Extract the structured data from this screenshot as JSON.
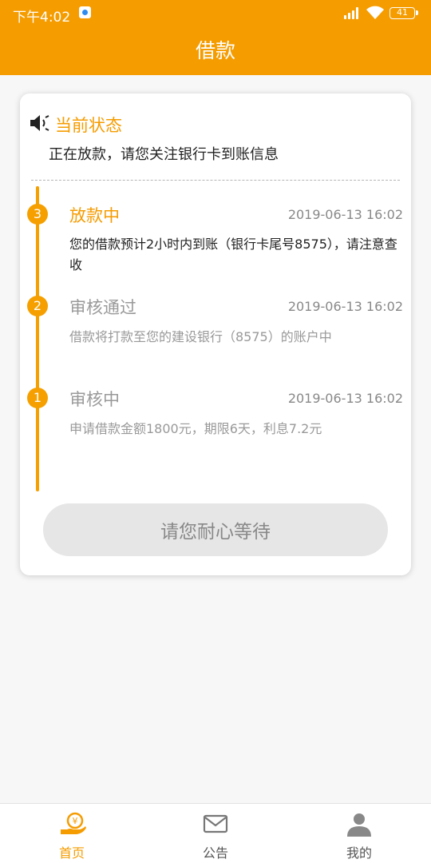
{
  "status_bar": {
    "time": "下午4:02",
    "battery": "41"
  },
  "header": {
    "title": "借款"
  },
  "status": {
    "title": "当前状态",
    "message": "正在放款，请您关注银行卡到账信息"
  },
  "timeline": [
    {
      "number": "3",
      "title": "放款中",
      "time": "2019-06-13 16:02",
      "desc": "您的借款预计2小时内到账（银行卡尾号8575），请注意查收",
      "state": "active"
    },
    {
      "number": "2",
      "title": "审核通过",
      "time": "2019-06-13 16:02",
      "desc": "借款将打款至您的建设银行（8575）的账户中",
      "state": "done"
    },
    {
      "number": "1",
      "title": "审核中",
      "time": "2019-06-13 16:02",
      "desc": "申请借款金额1800元，期限6天，利息7.2元",
      "state": "done"
    }
  ],
  "wait_button": {
    "label": "请您耐心等待"
  },
  "bottom_nav": {
    "items": [
      {
        "label": "首页",
        "icon": "home-loan-icon",
        "active": true
      },
      {
        "label": "公告",
        "icon": "mail-icon",
        "active": false
      },
      {
        "label": "我的",
        "icon": "user-icon",
        "active": false
      }
    ]
  },
  "colors": {
    "brand": "#f59c00",
    "active_text": "#222222",
    "muted_text": "#999999",
    "button_bg": "#e6e6e6"
  }
}
